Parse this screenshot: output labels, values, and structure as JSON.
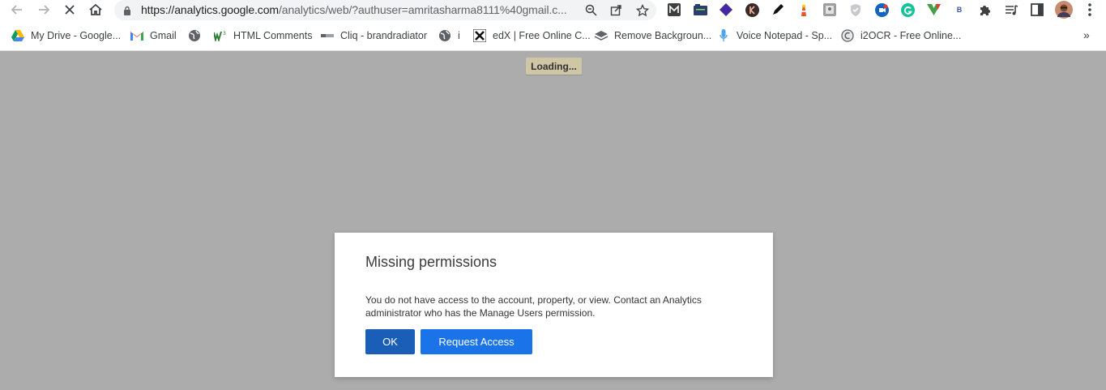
{
  "browser": {
    "url_host": "https://analytics.google.com",
    "url_rest": "/analytics/web/?authuser=amritasharma8111%40gmail.c...",
    "nav": [
      "back-icon",
      "forward-icon",
      "stop-icon",
      "home-icon"
    ],
    "omnibox_icons": [
      "zoom-icon",
      "share-icon",
      "star-icon"
    ],
    "extensions": [
      "m-extension-icon",
      "folder-extension-icon",
      "diamond-extension-icon",
      "k-extension-icon",
      "pen-extension-icon",
      "lighthouse-extension-icon",
      "photo-extension-icon",
      "shield-extension-icon",
      "camera-extension-icon",
      "grammarly-extension-icon",
      "vuetify-extension-icon",
      "b-extension-icon",
      "puzzle-icon",
      "media-icon",
      "side-panel-icon",
      "profile-avatar",
      "menu-icon"
    ],
    "b_ext_label": "B"
  },
  "bookmarks": [
    {
      "label": "My Drive - Google...",
      "icon": "drive-icon"
    },
    {
      "label": "Gmail",
      "icon": "gmail-icon"
    },
    {
      "label": "",
      "icon": "globe-icon"
    },
    {
      "label": "HTML Comments",
      "icon": "w3-icon"
    },
    {
      "label": "Cliq - brandradiator",
      "icon": "cliq-icon"
    },
    {
      "label": "i",
      "icon": "globe-icon"
    },
    {
      "label": "edX | Free Online C...",
      "icon": "edx-icon"
    },
    {
      "label": "Remove Backgroun...",
      "icon": "removebg-icon"
    },
    {
      "label": "Voice Notepad - Sp...",
      "icon": "mic-icon"
    },
    {
      "label": "i2OCR - Free Online...",
      "icon": "i2ocr-icon"
    }
  ],
  "bookmarks_more": "»",
  "page": {
    "loading": "Loading...",
    "dialog": {
      "title": "Missing permissions",
      "message": "You do not have access to the account, property, or view. Contact an Analytics administrator who has the Manage Users permission.",
      "ok_label": "OK",
      "request_label": "Request Access"
    }
  },
  "colors": {
    "overlay": "#acacac",
    "ok_button": "#1a5eb8",
    "request_button": "#1a73e8",
    "loading_bg": "#cfc6a6"
  }
}
